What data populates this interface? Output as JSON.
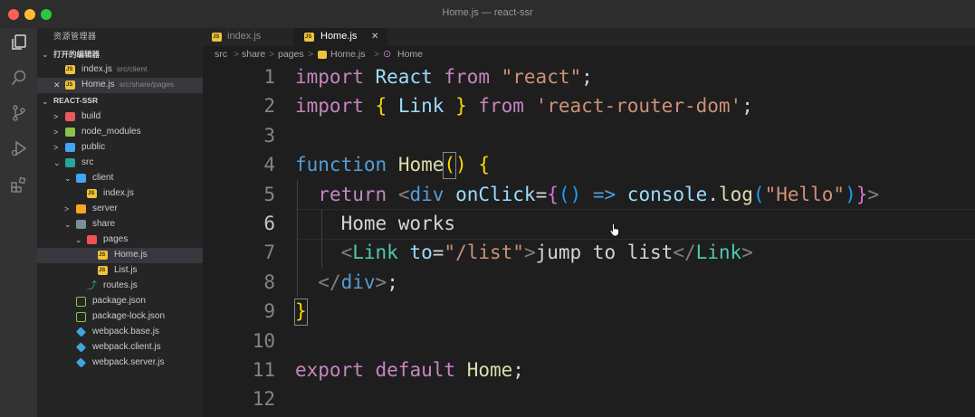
{
  "window": {
    "title": "Home.js — react-ssr"
  },
  "activity_bar": [
    {
      "name": "explorer-icon",
      "active": true
    },
    {
      "name": "search-icon",
      "active": false
    },
    {
      "name": "source-control-icon",
      "active": false
    },
    {
      "name": "run-debug-icon",
      "active": false
    },
    {
      "name": "extensions-icon",
      "active": false
    }
  ],
  "sidebar": {
    "title": "资源管理器",
    "open_editors_label": "打开的编辑器",
    "open_editors": [
      {
        "name": "index.js",
        "path": "src/client"
      },
      {
        "name": "Home.js",
        "path": "src/share/pages",
        "close": "✕"
      }
    ],
    "project_label": "REACT-SSR",
    "tree": [
      {
        "label": "build",
        "type": "folder",
        "color": "#e55b5b"
      },
      {
        "label": "node_modules",
        "type": "folder",
        "color": "#8bc34a"
      },
      {
        "label": "public",
        "type": "folder",
        "color": "#42a5f5"
      },
      {
        "label": "src",
        "type": "folder-open",
        "color": "#26a69a"
      },
      {
        "label": "client",
        "type": "folder-open",
        "color": "#42a5f5"
      },
      {
        "label": "index.js",
        "type": "js"
      },
      {
        "label": "server",
        "type": "folder",
        "color": "#f5a623"
      },
      {
        "label": "share",
        "type": "folder-open",
        "color": "#78909c"
      },
      {
        "label": "pages",
        "type": "folder-open",
        "color": "#ef5350"
      },
      {
        "label": "Home.js",
        "type": "js"
      },
      {
        "label": "List.js",
        "type": "js"
      },
      {
        "label": "routes.js",
        "type": "routes"
      },
      {
        "label": "package.json",
        "type": "json"
      },
      {
        "label": "package-lock.json",
        "type": "json"
      },
      {
        "label": "webpack.base.js",
        "type": "webpack"
      },
      {
        "label": "webpack.client.js",
        "type": "webpack"
      },
      {
        "label": "webpack.server.js",
        "type": "webpack"
      }
    ]
  },
  "tabs": [
    {
      "label": "index.js",
      "active": false
    },
    {
      "label": "Home.js",
      "active": true,
      "close": "✕"
    }
  ],
  "breadcrumb": [
    "src",
    "share",
    "pages",
    "Home.js",
    "Home"
  ],
  "breadcrumb_sep": ">",
  "editor": {
    "lines": [
      {
        "num": "1",
        "tokens": [
          [
            "kw",
            "import"
          ],
          [
            "t",
            " "
          ],
          [
            "var",
            "React"
          ],
          [
            "t",
            " "
          ],
          [
            "kw",
            "from"
          ],
          [
            "t",
            " "
          ],
          [
            "str",
            "\"react\""
          ],
          [
            "t",
            ";"
          ]
        ]
      },
      {
        "num": "2",
        "tokens": [
          [
            "kw",
            "import"
          ],
          [
            "t",
            " "
          ],
          [
            "gold",
            "{"
          ],
          [
            "t",
            " "
          ],
          [
            "var",
            "Link"
          ],
          [
            "t",
            " "
          ],
          [
            "gold",
            "}"
          ],
          [
            "t",
            " "
          ],
          [
            "kw",
            "from"
          ],
          [
            "t",
            " "
          ],
          [
            "str",
            "'react-router-dom'"
          ],
          [
            "t",
            ";"
          ]
        ]
      },
      {
        "num": "3",
        "tokens": []
      },
      {
        "num": "4",
        "tokens": [
          [
            "bl",
            "function"
          ],
          [
            "t",
            " "
          ],
          [
            "fn",
            "Home"
          ],
          [
            "gold",
            "()"
          ],
          [
            "t",
            " "
          ],
          [
            "gold",
            "{"
          ]
        ]
      },
      {
        "num": "5",
        "tokens": [
          [
            "t",
            "  "
          ],
          [
            "kw",
            "return"
          ],
          [
            "t",
            " "
          ],
          [
            "tag",
            "<"
          ],
          [
            "bl",
            "div"
          ],
          [
            "t",
            " "
          ],
          [
            "var",
            "onClick"
          ],
          [
            "t",
            "="
          ],
          [
            "pur",
            "{"
          ],
          [
            "skb",
            "()"
          ],
          [
            "t",
            " "
          ],
          [
            "bl",
            "=>"
          ],
          [
            "t",
            " "
          ],
          [
            "var",
            "console"
          ],
          [
            "t",
            "."
          ],
          [
            "fn",
            "log"
          ],
          [
            "skb",
            "("
          ],
          [
            "str",
            "\"Hello\""
          ],
          [
            "skb",
            ")"
          ],
          [
            "pur",
            "}"
          ],
          [
            "tag",
            ">"
          ]
        ]
      },
      {
        "num": "6",
        "tokens": [
          [
            "t",
            "    Home works"
          ]
        ]
      },
      {
        "num": "7",
        "tokens": [
          [
            "t",
            "    "
          ],
          [
            "tag",
            "<"
          ],
          [
            "ty",
            "Link"
          ],
          [
            "t",
            " "
          ],
          [
            "var",
            "to"
          ],
          [
            "t",
            "="
          ],
          [
            "str",
            "\"/list\""
          ],
          [
            "tag",
            ">"
          ],
          [
            "t",
            "jump to list"
          ],
          [
            "tag",
            "</"
          ],
          [
            "ty",
            "Link"
          ],
          [
            "tag",
            ">"
          ]
        ]
      },
      {
        "num": "8",
        "tokens": [
          [
            "t",
            "  "
          ],
          [
            "tag",
            "</"
          ],
          [
            "bl",
            "div"
          ],
          [
            "tag",
            ">"
          ],
          [
            "t",
            ";"
          ]
        ]
      },
      {
        "num": "9",
        "tokens": [
          [
            "gold",
            "}"
          ]
        ]
      },
      {
        "num": "10",
        "tokens": []
      },
      {
        "num": "11",
        "tokens": [
          [
            "kw",
            "export"
          ],
          [
            "t",
            " "
          ],
          [
            "kw",
            "default"
          ],
          [
            "t",
            " "
          ],
          [
            "fn",
            "Home"
          ],
          [
            "t",
            ";"
          ]
        ]
      },
      {
        "num": "12",
        "tokens": []
      }
    ],
    "current_line": "6"
  },
  "colors": {
    "kw": "#c586c0",
    "blue": "#569cd6",
    "var": "#9cdcfe",
    "str": "#ce9178",
    "fn": "#dcdcaa",
    "type": "#4ec9b0",
    "bracket": "#ffd700"
  }
}
